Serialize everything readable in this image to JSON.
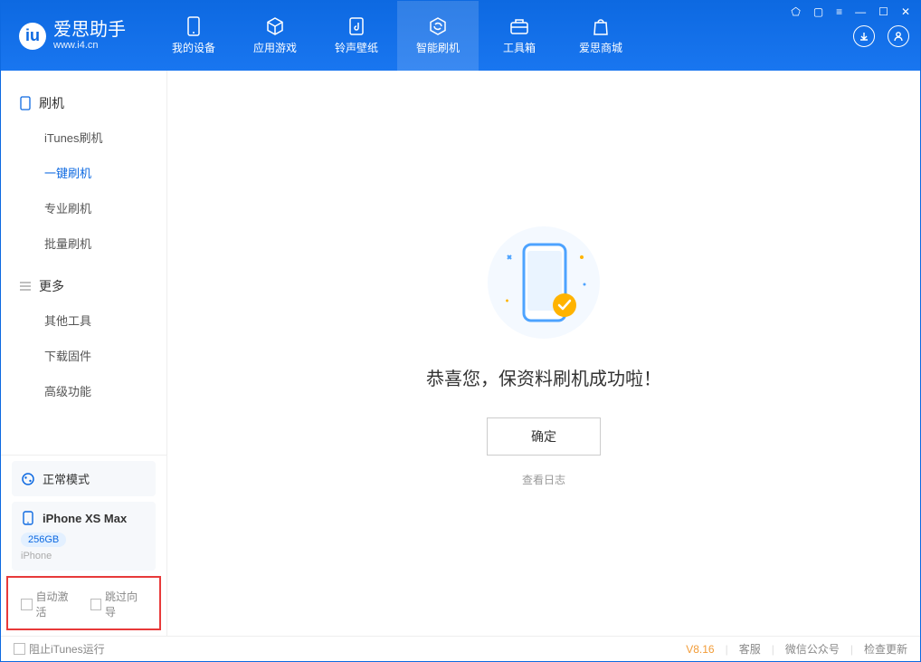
{
  "app": {
    "title": "爱思助手",
    "url": "www.i4.cn"
  },
  "tabs": [
    {
      "label": "我的设备"
    },
    {
      "label": "应用游戏"
    },
    {
      "label": "铃声壁纸"
    },
    {
      "label": "智能刷机"
    },
    {
      "label": "工具箱"
    },
    {
      "label": "爱思商城"
    }
  ],
  "sidebar": {
    "cat1": "刷机",
    "items1": [
      {
        "label": "iTunes刷机"
      },
      {
        "label": "一键刷机"
      },
      {
        "label": "专业刷机"
      },
      {
        "label": "批量刷机"
      }
    ],
    "cat2": "更多",
    "items2": [
      {
        "label": "其他工具"
      },
      {
        "label": "下载固件"
      },
      {
        "label": "高级功能"
      }
    ]
  },
  "mode": {
    "label": "正常模式"
  },
  "device": {
    "name": "iPhone XS Max",
    "storage": "256GB",
    "type": "iPhone"
  },
  "checkboxes": {
    "autoActivate": "自动激活",
    "skipGuide": "跳过向导"
  },
  "main": {
    "successTitle": "恭喜您，保资料刷机成功啦！",
    "okButton": "确定",
    "viewLog": "查看日志"
  },
  "statusbar": {
    "blockItunes": "阻止iTunes运行",
    "version": "V8.16",
    "service": "客服",
    "wechat": "微信公众号",
    "checkUpdate": "检查更新"
  }
}
